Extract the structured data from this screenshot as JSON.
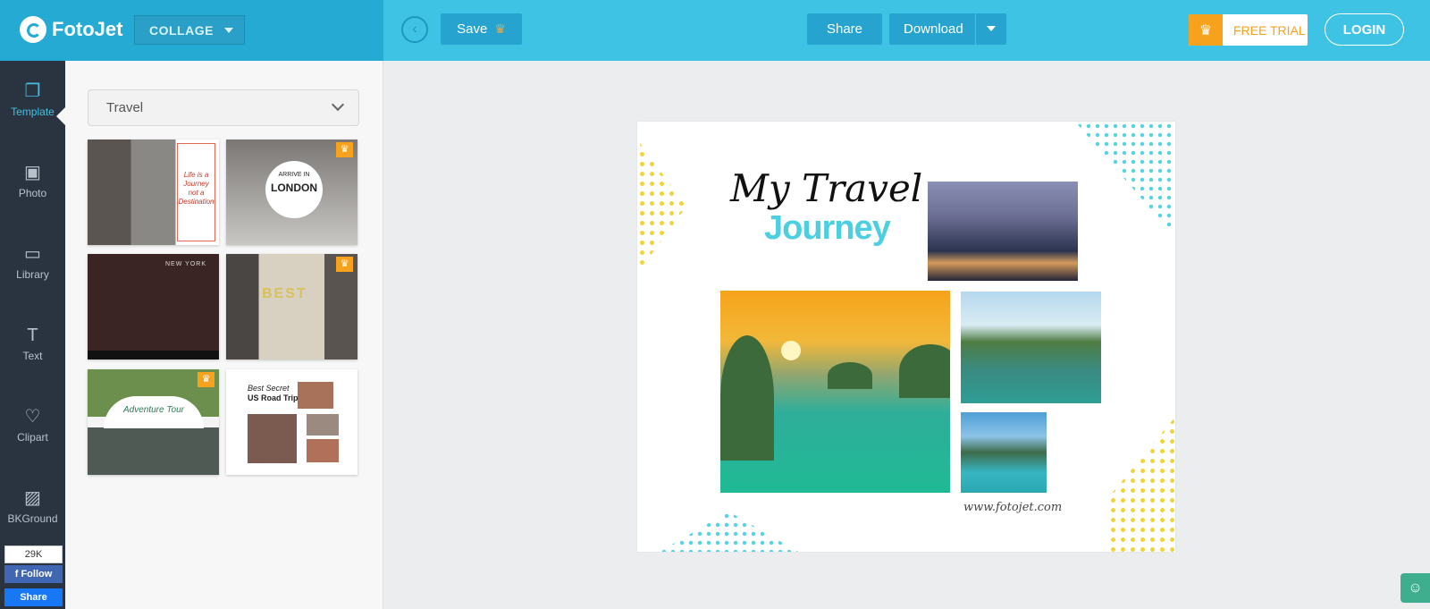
{
  "header": {
    "logo_text": "FotoJet",
    "mode_select": "COLLAGE",
    "back_icon": "‹",
    "save_label": "Save",
    "share_label": "Share",
    "download_label": "Download",
    "free_trial_label": "FREE TRIAL",
    "login_label": "LOGIN",
    "crown_icon": "♛"
  },
  "sidebar": {
    "items": [
      {
        "label": "Template",
        "icon": "template-icon",
        "glyph": "❐"
      },
      {
        "label": "Photo",
        "icon": "photo-icon",
        "glyph": "▣"
      },
      {
        "label": "Library",
        "icon": "library-icon",
        "glyph": "▭"
      },
      {
        "label": "Text",
        "icon": "text-icon",
        "glyph": "T"
      },
      {
        "label": "Clipart",
        "icon": "clipart-icon",
        "glyph": "♡"
      },
      {
        "label": "BKGround",
        "icon": "background-icon",
        "glyph": "▨"
      }
    ],
    "facebook": {
      "count": "29K",
      "follow_label": "Follow",
      "share_label": "Share"
    }
  },
  "panel": {
    "category": "Travel",
    "templates": [
      {
        "text": "Life is a Journey not a Destination",
        "pro": false
      },
      {
        "text": "ARRIVE IN",
        "text2": "LONDON",
        "pro": true
      },
      {
        "text": "NEW YORK",
        "pro": false
      },
      {
        "text": "BEST",
        "pro": true
      },
      {
        "text": "Adventure Tour",
        "pro": true
      },
      {
        "text": "Best Secret",
        "text2": "US Road Trips",
        "pro": false
      }
    ]
  },
  "canvas": {
    "title_line1": "My Travel",
    "title_line2": "Journey",
    "credit": "www.fotojet.com"
  },
  "colors": {
    "topbar": "#3ec3e5",
    "accent_orange": "#f7a21c",
    "sidenav": "#2a3440"
  }
}
